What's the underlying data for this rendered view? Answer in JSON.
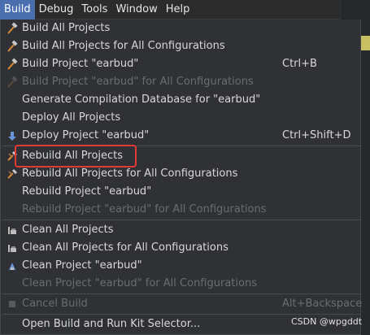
{
  "menubar": {
    "items": [
      {
        "label": "Build",
        "active": true
      },
      {
        "label": "Debug",
        "active": false
      },
      {
        "label": "Tools",
        "active": false
      },
      {
        "label": "Window",
        "active": false
      },
      {
        "label": "Help",
        "active": false
      }
    ]
  },
  "build_menu": {
    "items": [
      {
        "label": "Build All Projects",
        "shortcut": "",
        "icon": "hammer-icon",
        "disabled": false
      },
      {
        "label": "Build All Projects for All Configurations",
        "shortcut": "",
        "icon": "hammer-icon",
        "disabled": false
      },
      {
        "label": "Build Project \"earbud\"",
        "shortcut": "Ctrl+B",
        "icon": "hammer-icon",
        "disabled": false
      },
      {
        "label": "Build Project \"earbud\" for All Configurations",
        "shortcut": "",
        "icon": "hammer-icon",
        "disabled": true
      },
      {
        "label": "Generate Compilation Database for \"earbud\"",
        "shortcut": "",
        "icon": "",
        "disabled": false
      },
      {
        "label": "Deploy All Projects",
        "shortcut": "",
        "icon": "",
        "disabled": false
      },
      {
        "label": "Deploy Project \"earbud\"",
        "shortcut": "Ctrl+Shift+D",
        "icon": "deploy-icon",
        "disabled": false
      },
      {
        "label": "Rebuild All Projects",
        "shortcut": "",
        "icon": "rebuild-icon",
        "disabled": false
      },
      {
        "label": "Rebuild All Projects for All Configurations",
        "shortcut": "",
        "icon": "rebuild-icon",
        "disabled": false
      },
      {
        "label": "Rebuild Project \"earbud\"",
        "shortcut": "",
        "icon": "",
        "disabled": false
      },
      {
        "label": "Rebuild Project \"earbud\" for All Configurations",
        "shortcut": "",
        "icon": "",
        "disabled": true
      },
      {
        "label": "Clean All Projects",
        "shortcut": "",
        "icon": "clean-icon",
        "disabled": false
      },
      {
        "label": "Clean All Projects for All Configurations",
        "shortcut": "",
        "icon": "clean-icon",
        "disabled": false
      },
      {
        "label": "Clean Project \"earbud\"",
        "shortcut": "",
        "icon": "clean-icon",
        "disabled": false
      },
      {
        "label": "Clean Project \"earbud\" for All Configurations",
        "shortcut": "",
        "icon": "",
        "disabled": true
      },
      {
        "label": "Cancel Build",
        "shortcut": "Alt+Backspace",
        "icon": "stop-icon",
        "disabled": true
      },
      {
        "label": "Open Build and Run Kit Selector...",
        "shortcut": "",
        "icon": "",
        "disabled": false
      }
    ]
  },
  "watermark": "CSDN @wpgddt",
  "colors": {
    "menu_bg": "#2f3134",
    "menubar_active": "#4b6eaf",
    "highlight_box": "#e53935",
    "text": "#d8d8d8",
    "text_disabled": "#6a6d70"
  }
}
